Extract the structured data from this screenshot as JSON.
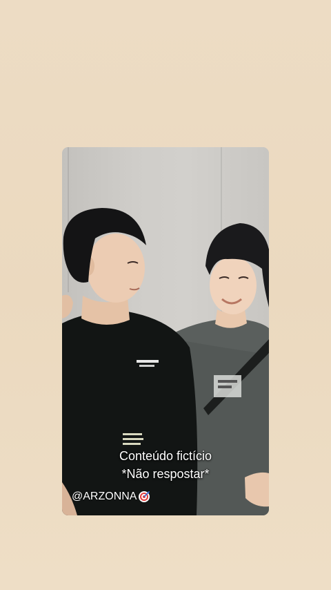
{
  "background_color": "#ecdcc3",
  "card": {
    "caption_line1": "Conteúdo fictício",
    "caption_line2": "*Não respostar*",
    "watermark": "@ARZONNA",
    "watermark_icon": "target-icon"
  },
  "colors": {
    "wall": "#cfcdc9",
    "shirt_left": "#121514",
    "shirt_right": "#585d5b",
    "caption_text": "#ffffff"
  }
}
